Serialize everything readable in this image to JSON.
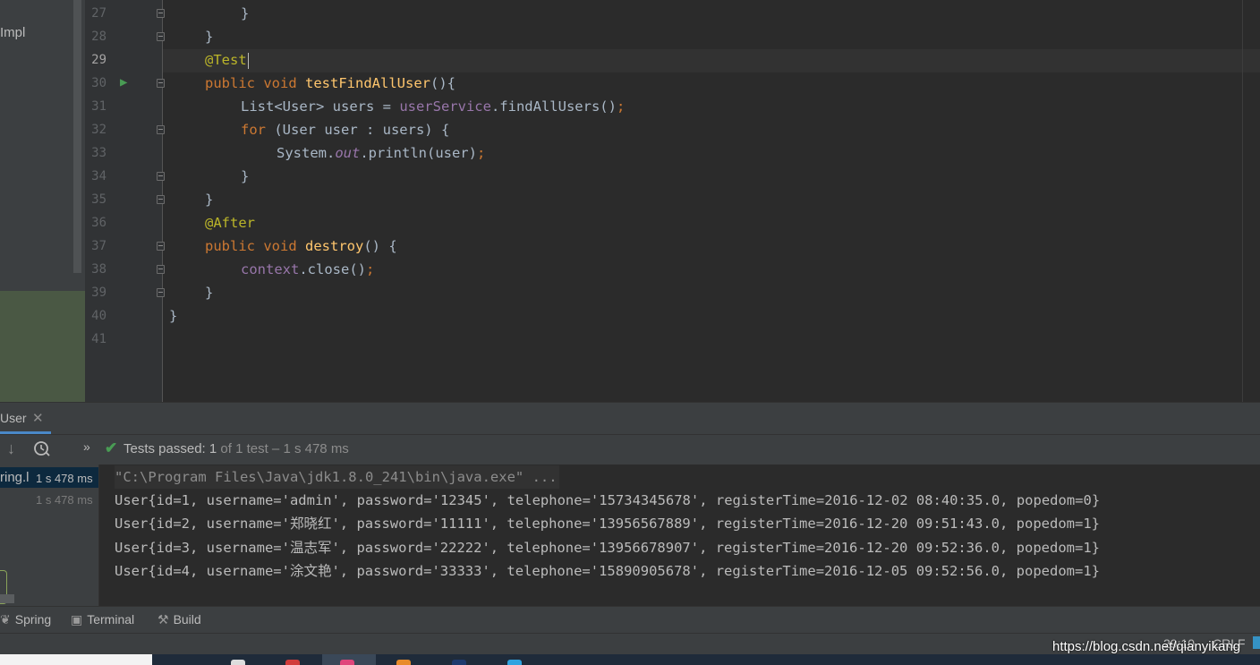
{
  "project_panel": {
    "partial_item": "Impl"
  },
  "editor": {
    "current_line": "29",
    "lines": [
      {
        "n": "27",
        "fold": true
      },
      {
        "n": "28",
        "fold": true
      },
      {
        "n": "29",
        "fold": false
      },
      {
        "n": "30",
        "fold": true
      },
      {
        "n": "31",
        "fold": false
      },
      {
        "n": "32",
        "fold": true
      },
      {
        "n": "33",
        "fold": false
      },
      {
        "n": "34",
        "fold": true
      },
      {
        "n": "35",
        "fold": true
      },
      {
        "n": "36",
        "fold": false
      },
      {
        "n": "37",
        "fold": true
      },
      {
        "n": "38",
        "fold": true
      },
      {
        "n": "39",
        "fold": true
      },
      {
        "n": "40",
        "fold": false
      },
      {
        "n": "41",
        "fold": false
      }
    ],
    "code": {
      "l27_brace": "}",
      "l28_brace": "}",
      "l29_annotation": "@Test",
      "l30_public": "public",
      "l30_void": "void",
      "l30_method": "testFindAllUser",
      "l30_rest": "(){",
      "l31_type": "List<User> users = ",
      "l31_field": "userService",
      "l31_call": ".findAllUsers()",
      "l31_semi": ";",
      "l32_for": "for",
      "l32_rest": " (User user : users) {",
      "l33_system": "System.",
      "l33_out": "out",
      "l33_call": ".println(user)",
      "l33_semi": ";",
      "l34_brace": "}",
      "l35_brace": "}",
      "l36_annotation": "@After",
      "l37_public": "public",
      "l37_void": "void",
      "l37_method": "destroy",
      "l37_rest": "() {",
      "l38_field": "context",
      "l38_call": ".close()",
      "l38_semi": ";",
      "l39_brace": "}",
      "l40_brace": "}"
    }
  },
  "run_window": {
    "tab_label": "User",
    "close_glyph": "✕",
    "toolbar": {
      "more_glyph": "»",
      "status_prefix": "Tests passed: ",
      "passed_count": "1",
      "status_suffix": " of 1 test – 1 s 478 ms"
    },
    "test_tree": {
      "row1_name": "ring.l",
      "row1_time": "1 s 478 ms",
      "row2_time": "1 s 478 ms"
    },
    "console_lines": [
      "\"C:\\Program Files\\Java\\jdk1.8.0_241\\bin\\java.exe\" ...",
      "User{id=1, username='admin', password='12345', telephone='15734345678', registerTime=2016-12-02 08:40:35.0, popedom=0}",
      "User{id=2, username='郑晓红', password='11111', telephone='13956567889', registerTime=2016-12-20 09:51:43.0, popedom=1}",
      "User{id=3, username='温志军', password='22222', telephone='13956678907', registerTime=2016-12-20 09:52:36.0, popedom=1}",
      "User{id=4, username='涂文艳', password='33333', telephone='15890905678', registerTime=2016-12-05 09:52:56.0, popedom=1}"
    ]
  },
  "tool_strip": {
    "spring": "Spring",
    "terminal": "Terminal",
    "build": "Build"
  },
  "status_bar": {
    "caret_position": "29:10",
    "line_separator": "CRLF"
  },
  "watermark": "https://blog.csdn.net/qianyikang",
  "icons": {
    "run": "run-test-icon",
    "check": "check-icon",
    "history": "history-icon",
    "down": "arrow-down-icon",
    "spring": "spring-icon",
    "terminal": "terminal-icon",
    "build": "hammer-icon"
  },
  "colors": {
    "keyword": "#cc7832",
    "annotation": "#bbb529",
    "method": "#ffc66d",
    "field": "#9876aa",
    "passed": "#499c54"
  }
}
